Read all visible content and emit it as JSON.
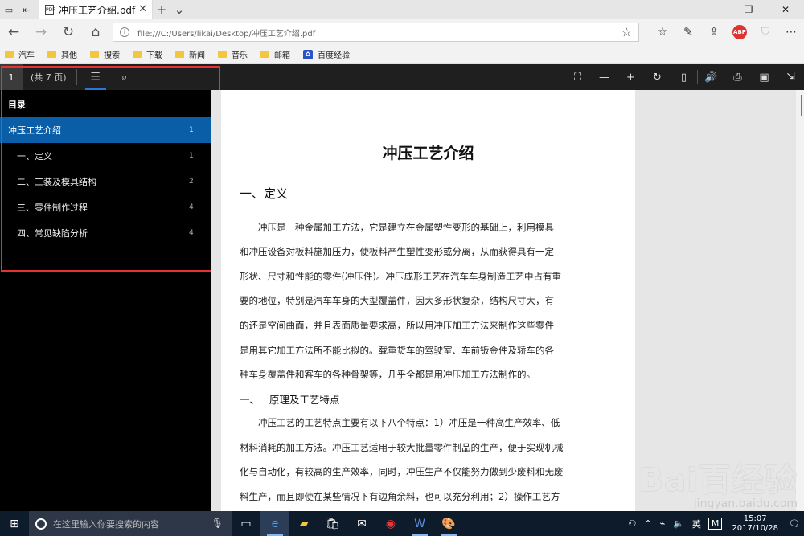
{
  "browser": {
    "tab_title": "冲压工艺介绍.pdf",
    "address_url": "file:///C:/Users/likai/Desktop/冲压工艺介绍.pdf",
    "abp_label": "ABP",
    "favorites": [
      "汽车",
      "其他",
      "搜索",
      "下载",
      "新闻",
      "音乐",
      "邮箱",
      "百度经验"
    ]
  },
  "pdf_toolbar": {
    "current_page": "1",
    "page_count": "(共 7 页)"
  },
  "toc": {
    "heading": "目录",
    "items": [
      {
        "label": "冲压工艺介绍",
        "page": "1"
      },
      {
        "label": "一、定义",
        "page": "1"
      },
      {
        "label": "二、工装及模具结构",
        "page": "2"
      },
      {
        "label": "三、零件制作过程",
        "page": "4"
      },
      {
        "label": "四、常见缺陷分析",
        "page": "4"
      }
    ]
  },
  "document": {
    "title": "冲压工艺介绍",
    "section1": "一、定义",
    "para1": [
      "冲压是一种金属加工方法，它是建立在金属塑性变形的基础上，利用模具",
      "和冲压设备对板料施加压力，使板料产生塑性变形或分离，从而获得具有一定",
      "形状、尺寸和性能的零件(冲压件)。冲压成形工艺在汽车车身制造工艺中占有重",
      "要的地位，特别是汽车车身的大型覆盖件，因大多形状复杂，结构尺寸大，有",
      "的还是空间曲面，并且表面质量要求高，所以用冲压加工方法来制作这些零件",
      "是用其它加工方法所不能比拟的。载重货车的驾驶室、车前钣金件及轿车的各",
      "种车身覆盖件和客车的各种骨架等，几乎全都是用冲压加工方法制作的。"
    ],
    "section2": "一、   原理及工艺特点",
    "para2": [
      "冲压工艺的工艺特点主要有以下八个特点：1）冲压是一种高生产效率、低",
      "材料消耗的加工方法。冲压工艺适用于较大批量零件制品的生产，便于实现机械",
      "化与自动化，有较高的生产效率，同时，冲压生产不仅能努力做到少废料和无废",
      "料生产，而且即使在某些情况下有边角余料，也可以充分利用；2）操作工艺方"
    ]
  },
  "watermark": {
    "brand": "Bai百经验",
    "url": "jingyan.baidu.com"
  },
  "taskbar": {
    "search_placeholder": "在这里输入你要搜索的内容",
    "ime_label": "英",
    "ime_mode": "M",
    "time": "15:07",
    "date": "2017/10/28"
  }
}
